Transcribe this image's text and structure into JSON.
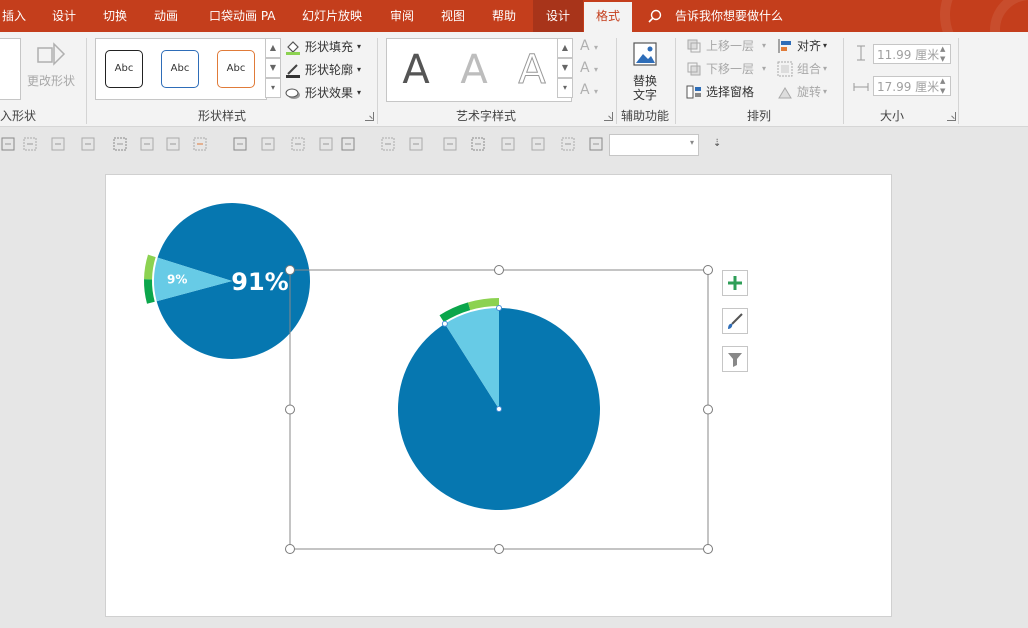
{
  "tabs": [
    {
      "label": "插入"
    },
    {
      "label": "设计"
    },
    {
      "label": "切换"
    },
    {
      "label": "动画"
    },
    {
      "label": "口袋动画 PA"
    },
    {
      "label": "幻灯片放映"
    },
    {
      "label": "审阅"
    },
    {
      "label": "视图"
    },
    {
      "label": "帮助"
    },
    {
      "label": "设计"
    },
    {
      "label": "格式"
    }
  ],
  "tell_me": "告诉我你想要做什么",
  "ribbon": {
    "insert_shapes": {
      "label": "入形状",
      "edit_shape": "更改形状"
    },
    "shape_styles": {
      "label": "形状样式",
      "presets": [
        "Abc",
        "Abc",
        "Abc"
      ],
      "fill": "形状填充",
      "outline": "形状轮廓",
      "effects": "形状效果"
    },
    "wordart": {
      "label": "艺术字样式",
      "letters": [
        "A",
        "A",
        "A"
      ]
    },
    "accessibility": {
      "label": "辅助功能",
      "alt_text_line1": "替换",
      "alt_text_line2": "文字"
    },
    "arrange": {
      "label": "排列",
      "bring_forward": "上移一层",
      "send_backward": "下移一层",
      "selection_pane": "选择窗格",
      "align": "对齐",
      "group": "组合",
      "rotate": "旋转"
    },
    "size": {
      "label": "大小",
      "height": "11.99 厘米",
      "width": "17.99 厘米"
    }
  },
  "colors": {
    "tab_bar": "#c43e1c",
    "pie_main": "#0677b0",
    "pie_slice": "#67cbe6",
    "ring_dark": "#0ba64b",
    "ring_light": "#8cd251",
    "accent_plus": "#2e9e57"
  },
  "icons": {
    "tell_me": "search-icon",
    "add_element": "plus-icon",
    "chart_style": "brush-icon",
    "chart_filter": "funnel-icon"
  },
  "chart_data": [
    {
      "type": "pie",
      "categories": [
        "91%",
        "9%"
      ],
      "values": [
        91,
        9
      ],
      "data_labels": [
        "91%",
        "9%"
      ]
    },
    {
      "type": "pie",
      "categories": [
        "",
        ""
      ],
      "values": [
        91,
        9
      ]
    }
  ]
}
